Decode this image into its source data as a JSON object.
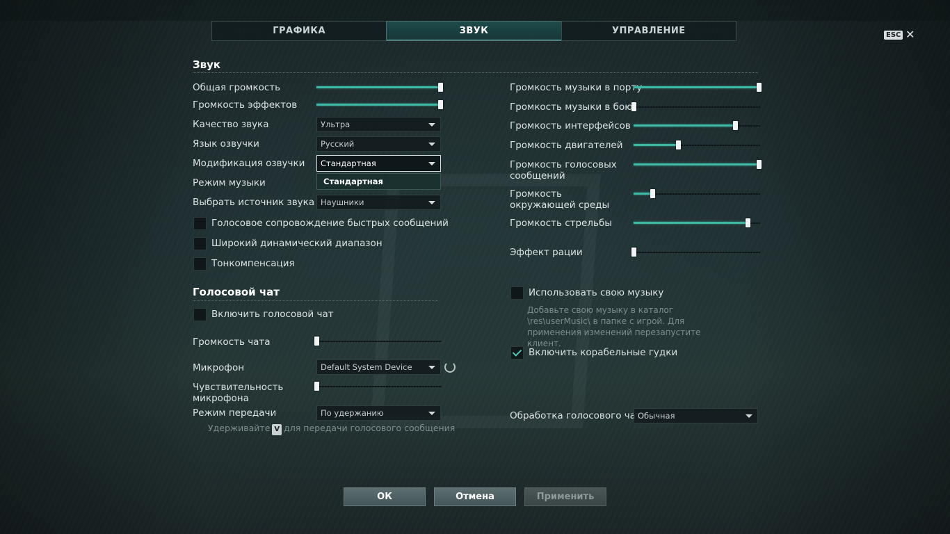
{
  "tabs": [
    "ГРАФИКА",
    "ЗВУК",
    "УПРАВЛЕНИЕ"
  ],
  "active_tab": 1,
  "close": {
    "esc_label": "ESC",
    "close_glyph": "✕"
  },
  "sound_section": {
    "title": "Звук",
    "general_volume": {
      "label": "Общая громкость",
      "value": 1.0
    },
    "effects_volume": {
      "label": "Громкость эффектов",
      "value": 1.0
    },
    "quality": {
      "label": "Качество звука",
      "value": "Ультра"
    },
    "voice_language": {
      "label": "Язык озвучки",
      "value": "Русский"
    },
    "voice_mod": {
      "label": "Модификация озвучки",
      "value": "Стандартная",
      "open_option": "Стандартная"
    },
    "music_mode": {
      "label": "Режим музыки"
    },
    "sound_source": {
      "label": "Выбрать источник звука",
      "value": "Наушники"
    },
    "checkboxes": [
      {
        "label": "Голосовое сопровождение быстрых сообщений",
        "checked": false
      },
      {
        "label": "Широкий динамический диапазон",
        "checked": false
      },
      {
        "label": "Тонкомпенсация",
        "checked": false
      }
    ]
  },
  "right_sliders": [
    {
      "label": "Громкость музыки в порту",
      "value": 1.0
    },
    {
      "label": "Громкость музыки в бою",
      "value": 0.0
    },
    {
      "label": "Громкость интерфейсов",
      "value": 0.8
    },
    {
      "label": "Громкость двигателей",
      "value": 0.35
    },
    {
      "label": "Громкость голосовых сообщений",
      "value": 1.0
    },
    {
      "label": "Громкость окружающей среды",
      "value": 0.15
    },
    {
      "label": "Громкость стрельбы",
      "value": 0.9
    },
    {
      "label": "Эффект рации",
      "value": 0.0
    }
  ],
  "custom_music": {
    "label": "Использовать свою музыку",
    "checked": false,
    "hint": "Добавьте свою музыку в каталог \\res\\userMusic\\ в папке с игрой. Для применения изменений перезапустите клиент."
  },
  "ship_horns": {
    "label": "Включить корабельные гудки",
    "checked": true
  },
  "voice_chat": {
    "title": "Голосовой чат",
    "enable": {
      "label": "Включить голосовой чат",
      "checked": false
    },
    "chat_volume": {
      "label": "Громкость чата",
      "value": 0.0
    },
    "microphone": {
      "label": "Микрофон",
      "value": "Default System Device"
    },
    "sensitivity": {
      "label": "Чувствительность микрофона",
      "value": 0.0
    },
    "transmit_mode": {
      "label": "Режим передачи",
      "value": "По удержанию"
    },
    "hint_prefix": "Удерживайте",
    "hint_key": "V",
    "hint_suffix": "для передачи голосового сообщения",
    "processing": {
      "label": "Обработка голосового чата",
      "value": "Обычная"
    }
  },
  "buttons": {
    "ok": "ОК",
    "cancel": "Отмена",
    "apply": "Применить"
  },
  "colors": {
    "accent": "#3fb7a5",
    "tab_active": "#1e4a4a"
  }
}
